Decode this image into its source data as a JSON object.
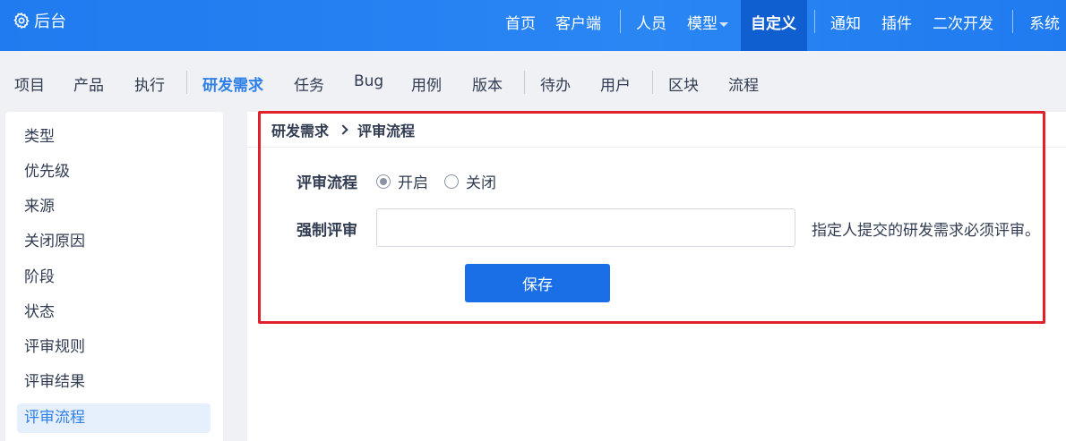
{
  "brand": {
    "icon": "gear-icon",
    "label": "后台"
  },
  "topnav": {
    "items": [
      "首页",
      "客户端",
      "人员",
      "模型",
      "自定义",
      "通知",
      "插件",
      "二次开发",
      "系统"
    ],
    "active": "自定义"
  },
  "subnav": {
    "items": [
      "项目",
      "产品",
      "执行",
      "研发需求",
      "任务",
      "Bug",
      "用例",
      "版本",
      "待办",
      "用户",
      "区块",
      "流程"
    ],
    "active": "研发需求"
  },
  "sidebar": {
    "items": [
      "类型",
      "优先级",
      "来源",
      "关闭原因",
      "阶段",
      "状态",
      "评审规则",
      "评审结果",
      "评审流程"
    ],
    "active": "评审流程"
  },
  "breadcrumb": {
    "parent": "研发需求",
    "current": "评审流程"
  },
  "form": {
    "review_flow_label": "评审流程",
    "option_on": "开启",
    "option_off": "关闭",
    "selected": "开启",
    "force_review_label": "强制评审",
    "force_review_value": "",
    "force_review_hint": "指定人提交的研发需求必须评审。",
    "save_label": "保存"
  },
  "colors": {
    "topbar": "#1f7bef",
    "accent": "#2e7fe6",
    "button": "#1a6fe6",
    "highlight": "#e0202a"
  }
}
